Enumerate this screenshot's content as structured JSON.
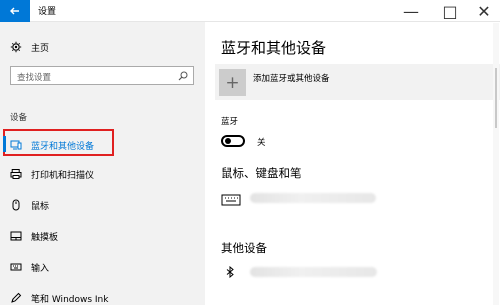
{
  "window": {
    "title": "设置",
    "controls": {
      "min": "—",
      "max": "□",
      "close": "✕"
    }
  },
  "sidebar": {
    "home_label": "主页",
    "search_placeholder": "查找设置",
    "section_title": "设备",
    "items": [
      {
        "label": "蓝牙和其他设备",
        "icon": "devices-icon",
        "active": true
      },
      {
        "label": "打印机和扫描仪",
        "icon": "printer-icon"
      },
      {
        "label": "鼠标",
        "icon": "mouse-icon"
      },
      {
        "label": "触摸板",
        "icon": "touchpad-icon"
      },
      {
        "label": "输入",
        "icon": "keyboard-icon"
      },
      {
        "label": "笔和 Windows Ink",
        "icon": "pen-icon"
      }
    ]
  },
  "main": {
    "title": "蓝牙和其他设备",
    "add_device_label": "添加蓝牙或其他设备",
    "bluetooth_label": "蓝牙",
    "bluetooth_state": "关",
    "kbd_section": "鼠标、键盘和笔",
    "other_section": "其他设备"
  },
  "colors": {
    "accent": "#0078d7",
    "highlight": "#e02020",
    "sidebar_bg": "#f2f2f2"
  }
}
